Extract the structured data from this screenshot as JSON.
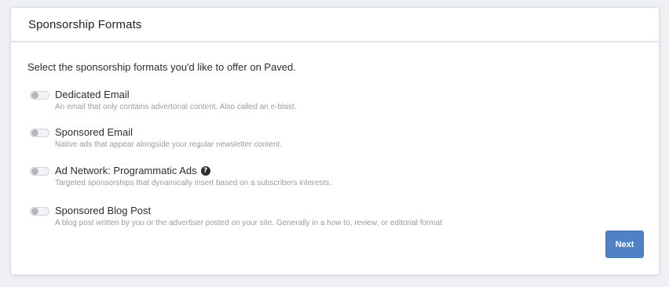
{
  "header": {
    "title": "Sponsorship Formats"
  },
  "intro_text": "Select the sponsorship formats you'd like to offer on Paved.",
  "options": [
    {
      "title": "Dedicated Email",
      "description": "An email that only contains advertorial content. Also called an e-blast.",
      "enabled": false
    },
    {
      "title": "Sponsored Email",
      "description": "Native ads that appear alongside your regular newsletter content.",
      "enabled": false
    },
    {
      "title": "Ad Network: Programmatic Ads",
      "description": "Targeted sponsorships that dynamically insert based on a subscribers interests.",
      "enabled": false,
      "help_icon": "?"
    },
    {
      "title": "Sponsored Blog Post",
      "description": "A blog post written by you or the advertiser posted on your site. Generally in a how to, review, or editorial format",
      "enabled": false
    }
  ],
  "actions": {
    "next_label": "Next"
  },
  "colors": {
    "accent": "#4f81c7",
    "toggle_off_knob": "#b5b7bd"
  }
}
